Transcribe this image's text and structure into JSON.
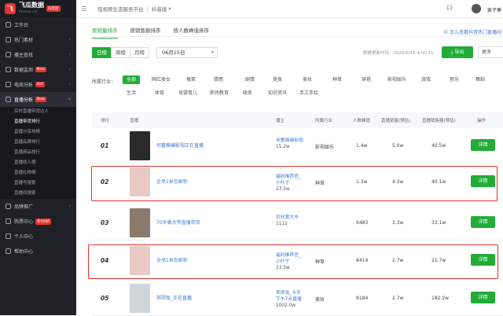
{
  "brand": {
    "mark": "飞",
    "name": "飞瓜数据",
    "domain": "FEIGUA.CN",
    "badge": "抖音版"
  },
  "sidebar": {
    "items": [
      {
        "label": "工作台",
        "badge": "",
        "active": false
      },
      {
        "label": "热门素材",
        "badge": "",
        "active": false
      },
      {
        "label": "播主查找",
        "badge": "",
        "active": false
      },
      {
        "label": "数据监测",
        "badge": "New",
        "active": false
      },
      {
        "label": "电商分析",
        "badge": "Hot",
        "active": false
      },
      {
        "label": "直播分析",
        "badge": "New",
        "active": true
      }
    ],
    "sub_items": [
      {
        "label": "实时直播带货达人",
        "active": false
      },
      {
        "label": "直播带货排行",
        "active": true
      },
      {
        "label": "直播分享热榜",
        "active": false
      },
      {
        "label": "直播品牌排行",
        "active": false
      },
      {
        "label": "直播商品排行",
        "active": false
      },
      {
        "label": "直播收入榜",
        "active": false
      },
      {
        "label": "直播礼物榜",
        "active": false
      },
      {
        "label": "直播号搜索",
        "active": false
      },
      {
        "label": "直播间搜索",
        "active": false
      }
    ],
    "bottom_items": [
      {
        "label": "品牌推广",
        "badge": ""
      },
      {
        "label": "购票中心",
        "badge": "年付8折"
      },
      {
        "label": "个人中心",
        "badge": ""
      },
      {
        "label": "帮助中心",
        "badge": ""
      }
    ]
  },
  "topbar": {
    "crumb1": "短视频生态服务平台",
    "crumb2": "抖音版",
    "user": "疯子寒"
  },
  "tabs": [
    {
      "label": "按销量排序",
      "active": true
    },
    {
      "label": "按销售额排序",
      "active": false
    },
    {
      "label": "按人数峰值排序",
      "active": false
    }
  ],
  "help_link": "怎么查看抖音热门直播间",
  "period": [
    {
      "label": "日榜",
      "active": true
    },
    {
      "label": "周榜",
      "active": false
    },
    {
      "label": "月榜",
      "active": false
    }
  ],
  "date": "06月15日",
  "update_text": "数据更新时间：2020/6/16 4:00:11",
  "export_label": "导出",
  "more_label": "更多",
  "industry_label": "所属行业：",
  "industries_row1": [
    "全部",
    "网红美女",
    "搞笑",
    "情感",
    "剧情",
    "美食",
    "美妆",
    "种草",
    "穿搭",
    "影视娱乐",
    "游戏",
    "音乐",
    "舞蹈"
  ],
  "industries_row2": [
    "生活",
    "体育",
    "母婴育儿",
    "职场教育",
    "政务",
    "知识资讯",
    "手工手绘"
  ],
  "table": {
    "headers": {
      "rank": "排行",
      "live": "直播",
      "host": "播主",
      "industry": "所属行业",
      "peak": "人数峰值",
      "sales": "直播销量(预估)",
      "amount": "直播销售额(预估)",
      "action": "操作"
    },
    "rows": [
      {
        "rank": "01",
        "title": "何蔷薇编影视正在直播",
        "host1": "何蔷薇编影视",
        "host2": "",
        "fans": "15.2w",
        "industry": "影视娱乐",
        "peak": "1.4w",
        "sales": "5.0w",
        "amount": "40.5w",
        "action": "详情",
        "thumb_color": "#2a2a2a"
      },
      {
        "rank": "02",
        "title": "全场1米包邮秒",
        "host1": "福利推荐官_",
        "host2": "小叶子",
        "fans": "23.5w",
        "industry": "种草",
        "peak": "1.3w",
        "sales": "4.3w",
        "amount": "40.1w",
        "action": "详情",
        "thumb_color": "#e8c9c4"
      },
      {
        "rank": "03",
        "title": "70岁黄大爷直播带货",
        "host1": "农村黄大爷",
        "host2": "",
        "fans": "1112",
        "industry": "",
        "peak": "6483",
        "sales": "3.3w",
        "amount": "33.1w",
        "action": "详情",
        "thumb_color": "#8a7a6a"
      },
      {
        "rank": "04",
        "title": "全场1米包邮秒",
        "host1": "福利推荐官_",
        "host2": "小叶子",
        "fans": "23.5w",
        "industry": "种草",
        "peak": "8414",
        "sales": "2.7w",
        "amount": "21.7w",
        "action": "详情",
        "thumb_color": "#e8c9c4"
      },
      {
        "rank": "05",
        "title": "郑郑兔_正在直播",
        "host1": "郑郑兔_今天",
        "host2": "下午7点直播",
        "fans": "1002.0w",
        "industry": "美妆",
        "peak": "8184",
        "sales": "2.7w",
        "amount": "182.2w",
        "action": "详情",
        "thumb_color": "#cfd6dc"
      }
    ]
  }
}
